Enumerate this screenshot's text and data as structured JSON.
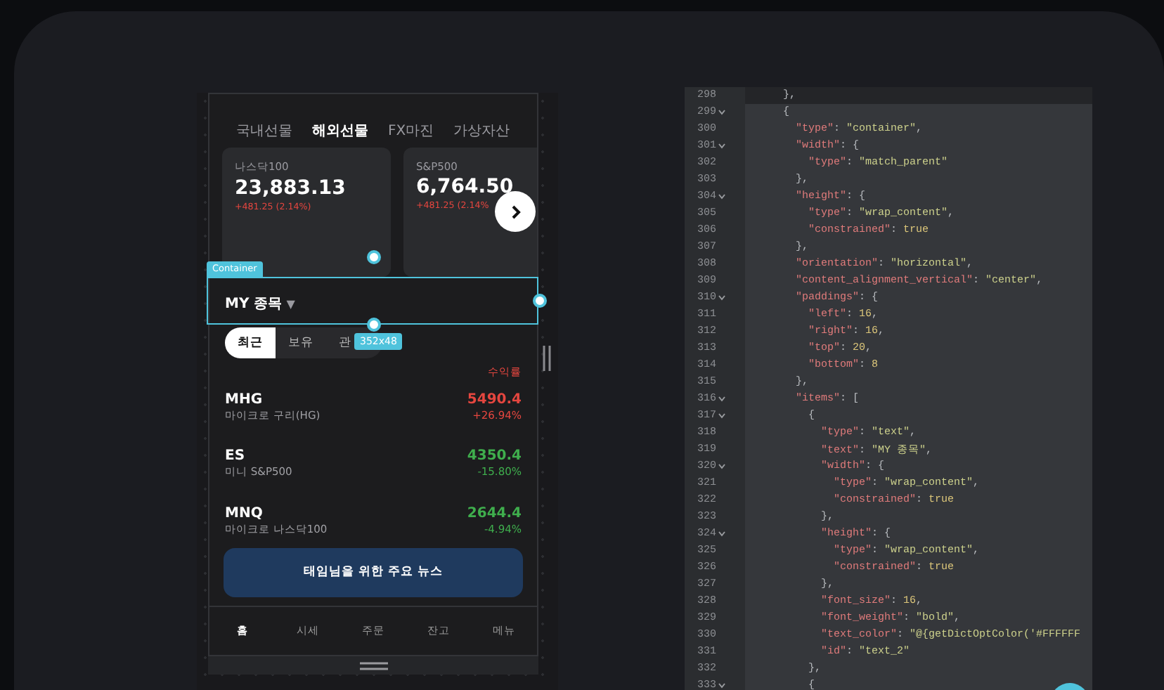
{
  "phone": {
    "tabs": [
      {
        "label": "국내선물",
        "selected": false
      },
      {
        "label": "해외선물",
        "selected": true
      },
      {
        "label": "FX마진",
        "selected": false
      },
      {
        "label": "가상자산",
        "selected": false
      }
    ],
    "cards": [
      {
        "name": "나스닥100",
        "price": "23,883.13",
        "change": "+481.25 (2.14%)",
        "color": "#e5463f"
      },
      {
        "name": "S&P500",
        "price": "6,764.50",
        "change": "+481.25 (2.14%",
        "color": "#e5463f"
      }
    ],
    "section": {
      "title": "MY 종목",
      "caret": "▼"
    },
    "selection": {
      "label": "Container",
      "size": "352x48"
    },
    "filters": [
      {
        "label": "최근",
        "selected": true
      },
      {
        "label": "보유",
        "selected": false
      },
      {
        "label": "관",
        "selected": false
      }
    ],
    "column_header": "수익률",
    "rows": [
      {
        "symbol": "MHG",
        "name": "마이크로 구리(HG)",
        "price": "5490.4",
        "change": "+26.94%",
        "color": "#e5463f"
      },
      {
        "symbol": "ES",
        "name": "미니 S&P500",
        "price": "4350.4",
        "change": "-15.80%",
        "color": "#3fae4d"
      },
      {
        "symbol": "MNQ",
        "name": "마이크로 나스닥100",
        "price": "2644.4",
        "change": "-4.94%",
        "color": "#3fae4d"
      }
    ],
    "news_button": "태임님을 위한 주요 뉴스",
    "nav": [
      {
        "label": "홈",
        "selected": true
      },
      {
        "label": "시세",
        "selected": false
      },
      {
        "label": "주문",
        "selected": false
      },
      {
        "label": "잔고",
        "selected": false
      },
      {
        "label": "메뉴",
        "selected": false
      }
    ]
  },
  "editor": {
    "lines": [
      {
        "number": "298",
        "fold": false,
        "current": true,
        "tokens": [
          {
            "kind": "punct",
            "text": "},"
          }
        ]
      },
      {
        "number": "299",
        "fold": true,
        "current": false,
        "tokens": [
          {
            "kind": "punct",
            "text": "{"
          }
        ]
      },
      {
        "number": "300",
        "fold": false,
        "current": false,
        "tokens": [
          {
            "kind": "key",
            "text": "  \"type\""
          },
          {
            "kind": "punct",
            "text": ": "
          },
          {
            "kind": "string",
            "text": "\"container\""
          },
          {
            "kind": "punct",
            "text": ","
          }
        ]
      },
      {
        "number": "301",
        "fold": true,
        "current": false,
        "tokens": [
          {
            "kind": "key",
            "text": "  \"width\""
          },
          {
            "kind": "punct",
            "text": ": {"
          }
        ]
      },
      {
        "number": "302",
        "fold": false,
        "current": false,
        "tokens": [
          {
            "kind": "key",
            "text": "    \"type\""
          },
          {
            "kind": "punct",
            "text": ": "
          },
          {
            "kind": "string",
            "text": "\"match_parent\""
          }
        ]
      },
      {
        "number": "303",
        "fold": false,
        "current": false,
        "tokens": [
          {
            "kind": "punct",
            "text": "  },"
          }
        ]
      },
      {
        "number": "304",
        "fold": true,
        "current": false,
        "tokens": [
          {
            "kind": "key",
            "text": "  \"height\""
          },
          {
            "kind": "punct",
            "text": ": {"
          }
        ]
      },
      {
        "number": "305",
        "fold": false,
        "current": false,
        "tokens": [
          {
            "kind": "key",
            "text": "    \"type\""
          },
          {
            "kind": "punct",
            "text": ": "
          },
          {
            "kind": "string",
            "text": "\"wrap_content\""
          },
          {
            "kind": "punct",
            "text": ","
          }
        ]
      },
      {
        "number": "306",
        "fold": false,
        "current": false,
        "tokens": [
          {
            "kind": "key",
            "text": "    \"constrained\""
          },
          {
            "kind": "punct",
            "text": ": "
          },
          {
            "kind": "literal",
            "text": "true"
          }
        ]
      },
      {
        "number": "307",
        "fold": false,
        "current": false,
        "tokens": [
          {
            "kind": "punct",
            "text": "  },"
          }
        ]
      },
      {
        "number": "308",
        "fold": false,
        "current": false,
        "tokens": [
          {
            "kind": "key",
            "text": "  \"orientation\""
          },
          {
            "kind": "punct",
            "text": ": "
          },
          {
            "kind": "string",
            "text": "\"horizontal\""
          },
          {
            "kind": "punct",
            "text": ","
          }
        ]
      },
      {
        "number": "309",
        "fold": false,
        "current": false,
        "tokens": [
          {
            "kind": "key",
            "text": "  \"content_alignment_vertical\""
          },
          {
            "kind": "punct",
            "text": ": "
          },
          {
            "kind": "string",
            "text": "\"center\""
          },
          {
            "kind": "punct",
            "text": ","
          }
        ]
      },
      {
        "number": "310",
        "fold": true,
        "current": false,
        "tokens": [
          {
            "kind": "key",
            "text": "  \"paddings\""
          },
          {
            "kind": "punct",
            "text": ": {"
          }
        ]
      },
      {
        "number": "311",
        "fold": false,
        "current": false,
        "tokens": [
          {
            "kind": "key",
            "text": "    \"left\""
          },
          {
            "kind": "punct",
            "text": ": "
          },
          {
            "kind": "literal",
            "text": "16"
          },
          {
            "kind": "punct",
            "text": ","
          }
        ]
      },
      {
        "number": "312",
        "fold": false,
        "current": false,
        "tokens": [
          {
            "kind": "key",
            "text": "    \"right\""
          },
          {
            "kind": "punct",
            "text": ": "
          },
          {
            "kind": "literal",
            "text": "16"
          },
          {
            "kind": "punct",
            "text": ","
          }
        ]
      },
      {
        "number": "313",
        "fold": false,
        "current": false,
        "tokens": [
          {
            "kind": "key",
            "text": "    \"top\""
          },
          {
            "kind": "punct",
            "text": ": "
          },
          {
            "kind": "literal",
            "text": "20"
          },
          {
            "kind": "punct",
            "text": ","
          }
        ]
      },
      {
        "number": "314",
        "fold": false,
        "current": false,
        "tokens": [
          {
            "kind": "key",
            "text": "    \"bottom\""
          },
          {
            "kind": "punct",
            "text": ": "
          },
          {
            "kind": "literal",
            "text": "8"
          }
        ]
      },
      {
        "number": "315",
        "fold": false,
        "current": false,
        "tokens": [
          {
            "kind": "punct",
            "text": "  },"
          }
        ]
      },
      {
        "number": "316",
        "fold": true,
        "current": false,
        "tokens": [
          {
            "kind": "key",
            "text": "  \"items\""
          },
          {
            "kind": "punct",
            "text": ": ["
          }
        ]
      },
      {
        "number": "317",
        "fold": true,
        "current": false,
        "tokens": [
          {
            "kind": "punct",
            "text": "    {"
          }
        ]
      },
      {
        "number": "318",
        "fold": false,
        "current": false,
        "tokens": [
          {
            "kind": "key",
            "text": "      \"type\""
          },
          {
            "kind": "punct",
            "text": ": "
          },
          {
            "kind": "string",
            "text": "\"text\""
          },
          {
            "kind": "punct",
            "text": ","
          }
        ]
      },
      {
        "number": "319",
        "fold": false,
        "current": false,
        "tokens": [
          {
            "kind": "key",
            "text": "      \"text\""
          },
          {
            "kind": "punct",
            "text": ": "
          },
          {
            "kind": "string",
            "text": "\"MY 종목\""
          },
          {
            "kind": "punct",
            "text": ","
          }
        ]
      },
      {
        "number": "320",
        "fold": true,
        "current": false,
        "tokens": [
          {
            "kind": "key",
            "text": "      \"width\""
          },
          {
            "kind": "punct",
            "text": ": {"
          }
        ]
      },
      {
        "number": "321",
        "fold": false,
        "current": false,
        "tokens": [
          {
            "kind": "key",
            "text": "        \"type\""
          },
          {
            "kind": "punct",
            "text": ": "
          },
          {
            "kind": "string",
            "text": "\"wrap_content\""
          },
          {
            "kind": "punct",
            "text": ","
          }
        ]
      },
      {
        "number": "322",
        "fold": false,
        "current": false,
        "tokens": [
          {
            "kind": "key",
            "text": "        \"constrained\""
          },
          {
            "kind": "punct",
            "text": ": "
          },
          {
            "kind": "literal",
            "text": "true"
          }
        ]
      },
      {
        "number": "323",
        "fold": false,
        "current": false,
        "tokens": [
          {
            "kind": "punct",
            "text": "      },"
          }
        ]
      },
      {
        "number": "324",
        "fold": true,
        "current": false,
        "tokens": [
          {
            "kind": "key",
            "text": "      \"height\""
          },
          {
            "kind": "punct",
            "text": ": {"
          }
        ]
      },
      {
        "number": "325",
        "fold": false,
        "current": false,
        "tokens": [
          {
            "kind": "key",
            "text": "        \"type\""
          },
          {
            "kind": "punct",
            "text": ": "
          },
          {
            "kind": "string",
            "text": "\"wrap_content\""
          },
          {
            "kind": "punct",
            "text": ","
          }
        ]
      },
      {
        "number": "326",
        "fold": false,
        "current": false,
        "tokens": [
          {
            "kind": "key",
            "text": "        \"constrained\""
          },
          {
            "kind": "punct",
            "text": ": "
          },
          {
            "kind": "literal",
            "text": "true"
          }
        ]
      },
      {
        "number": "327",
        "fold": false,
        "current": false,
        "tokens": [
          {
            "kind": "punct",
            "text": "      },"
          }
        ]
      },
      {
        "number": "328",
        "fold": false,
        "current": false,
        "tokens": [
          {
            "kind": "key",
            "text": "      \"font_size\""
          },
          {
            "kind": "punct",
            "text": ": "
          },
          {
            "kind": "literal",
            "text": "16"
          },
          {
            "kind": "punct",
            "text": ","
          }
        ]
      },
      {
        "number": "329",
        "fold": false,
        "current": false,
        "tokens": [
          {
            "kind": "key",
            "text": "      \"font_weight\""
          },
          {
            "kind": "punct",
            "text": ": "
          },
          {
            "kind": "string",
            "text": "\"bold\""
          },
          {
            "kind": "punct",
            "text": ","
          }
        ]
      },
      {
        "number": "330",
        "fold": false,
        "current": false,
        "tokens": [
          {
            "kind": "key",
            "text": "      \"text_color\""
          },
          {
            "kind": "punct",
            "text": ": "
          },
          {
            "kind": "string",
            "text": "\"@{getDictOptColor('#FFFFFF"
          }
        ]
      },
      {
        "number": "331",
        "fold": false,
        "current": false,
        "tokens": [
          {
            "kind": "key",
            "text": "      \"id\""
          },
          {
            "kind": "punct",
            "text": ": "
          },
          {
            "kind": "string",
            "text": "\"text_2\""
          }
        ]
      },
      {
        "number": "332",
        "fold": false,
        "current": false,
        "tokens": [
          {
            "kind": "punct",
            "text": "    },"
          }
        ]
      },
      {
        "number": "333",
        "fold": true,
        "current": false,
        "tokens": [
          {
            "kind": "punct",
            "text": "    {"
          }
        ]
      }
    ]
  }
}
